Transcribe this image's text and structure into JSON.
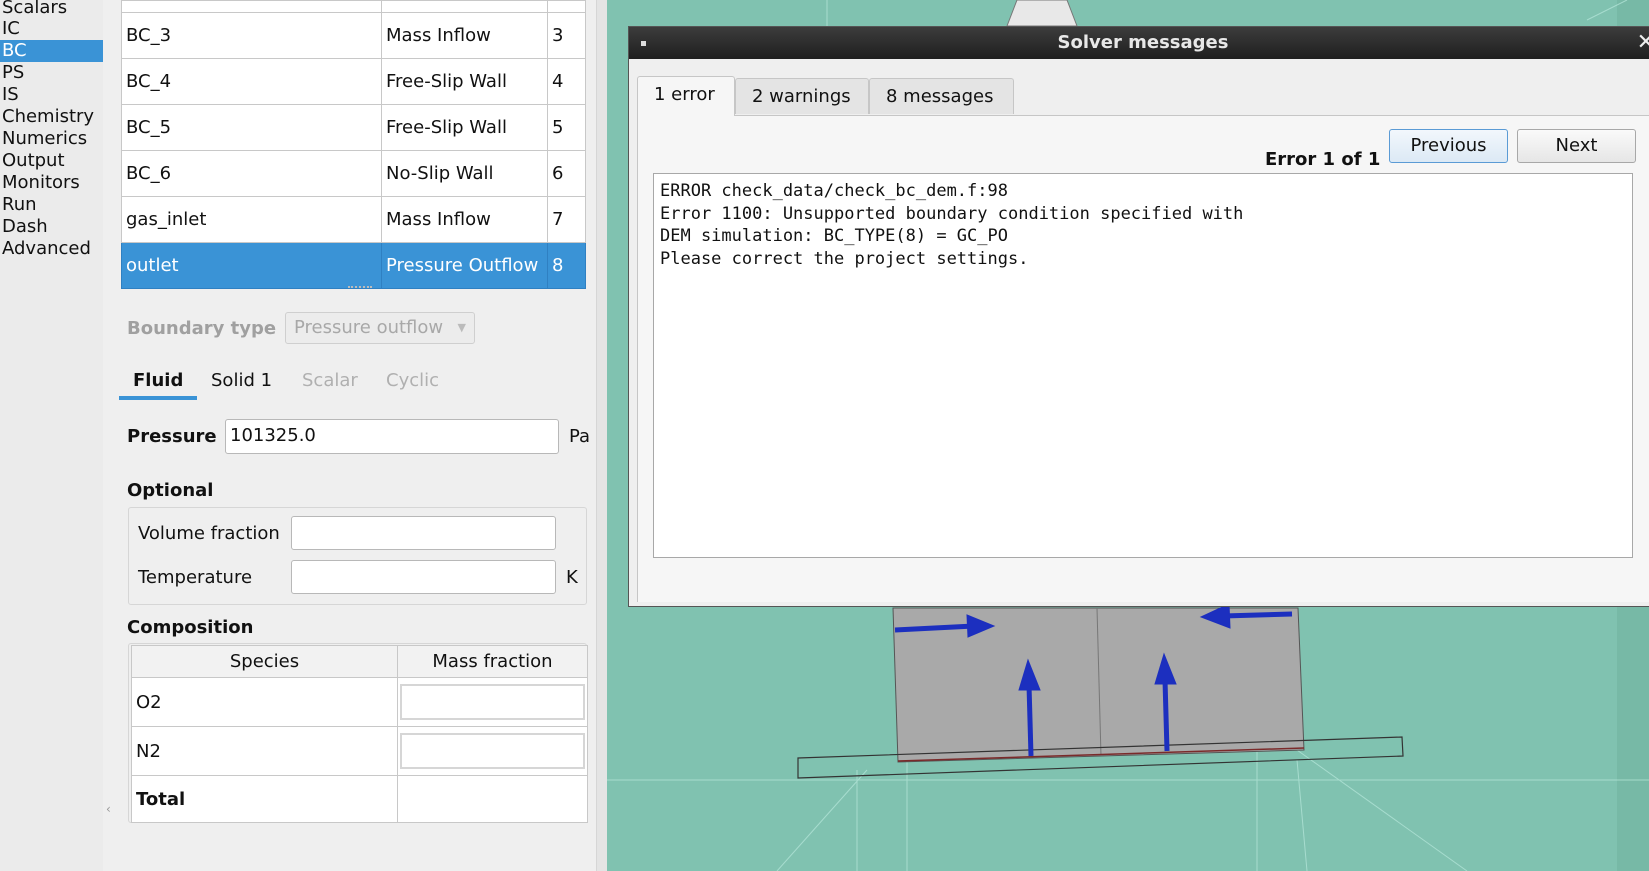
{
  "nav": {
    "items": [
      "Scalars",
      "IC",
      "BC",
      "PS",
      "IS",
      "Chemistry",
      "Numerics",
      "Output",
      "Monitors",
      "Run",
      "Dash",
      "Advanced"
    ],
    "selected": "BC"
  },
  "bc_table": {
    "rows": [
      {
        "name": "BC_3",
        "type": "Mass Inflow",
        "id": "3"
      },
      {
        "name": "BC_4",
        "type": "Free-Slip Wall",
        "id": "4"
      },
      {
        "name": "BC_5",
        "type": "Free-Slip Wall",
        "id": "5"
      },
      {
        "name": "BC_6",
        "type": "No-Slip Wall",
        "id": "6"
      },
      {
        "name": "gas_inlet",
        "type": "Mass Inflow",
        "id": "7"
      },
      {
        "name": "outlet",
        "type": "Pressure Outflow",
        "id": "8"
      }
    ],
    "selected_row": "outlet"
  },
  "boundary": {
    "type_label": "Boundary type",
    "type_value": "Pressure outflow"
  },
  "phase_tabs": [
    {
      "label": "Fluid",
      "active": true,
      "enabled": true
    },
    {
      "label": "Solid 1",
      "active": false,
      "enabled": true
    },
    {
      "label": "Scalar",
      "active": false,
      "enabled": false
    },
    {
      "label": "Cyclic",
      "active": false,
      "enabled": false
    }
  ],
  "pressure": {
    "label": "Pressure",
    "value": "101325.0",
    "unit": "Pa"
  },
  "optional": {
    "title": "Optional",
    "volume_fraction_label": "Volume fraction",
    "volume_fraction_value": "",
    "temperature_label": "Temperature",
    "temperature_value": "",
    "temperature_unit": "K"
  },
  "composition": {
    "title": "Composition",
    "headers": [
      "Species",
      "Mass fraction"
    ],
    "rows": [
      {
        "species": "O2",
        "fraction": ""
      },
      {
        "species": "N2",
        "fraction": ""
      }
    ],
    "total_label": "Total",
    "total_value": ""
  },
  "dialog": {
    "title": "Solver messages",
    "tabs": [
      "1 error",
      "2 warnings",
      "8 messages"
    ],
    "active_tab": "1 error",
    "counter": "Error 1 of 1",
    "prev_label": "Previous",
    "next_label": "Next",
    "message_lines": [
      "ERROR check_data/check_bc_dem.f:98",
      "Error 1100: Unsupported boundary condition specified with",
      "DEM simulation: BC_TYPE(8) = GC_PO",
      "Please correct the project settings."
    ]
  },
  "colors": {
    "accent": "#3a93d6",
    "viewport": "#80c2b0",
    "arrow": "#1c2fbf"
  }
}
